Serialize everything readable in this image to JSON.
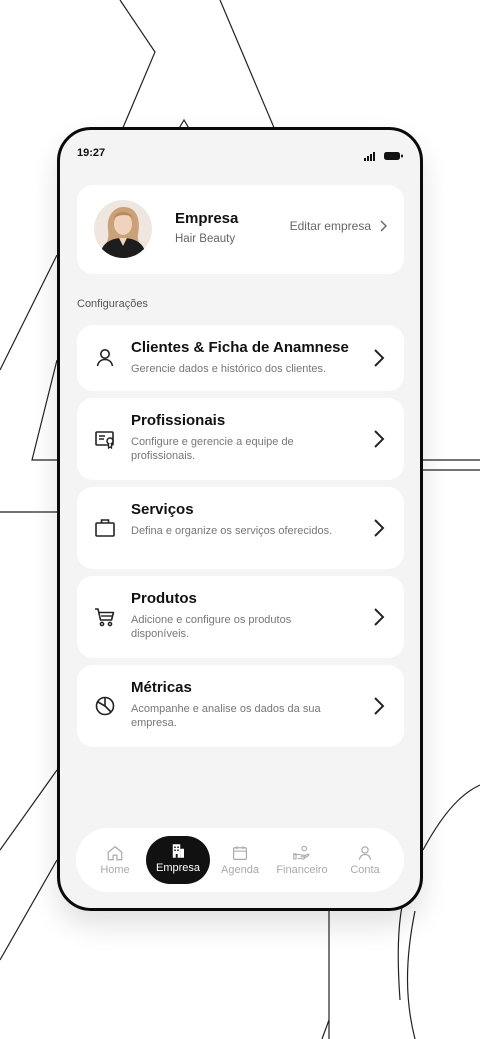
{
  "status_bar": {
    "time": "19:27"
  },
  "company": {
    "name": "Empresa",
    "subtitle": "Hair Beauty",
    "edit_label": "Editar empresa"
  },
  "section_label": "Configurações",
  "menu": [
    {
      "title": "Clientes & Ficha de Anamnese",
      "desc": "Gerencie dados e histórico dos clientes.",
      "icon": "user-icon"
    },
    {
      "title": "Profissionais",
      "desc": "Configure e gerencie a equipe de profissionais.",
      "icon": "id-badge-icon"
    },
    {
      "title": "Serviços",
      "desc": "Defina e organize os serviços oferecidos.",
      "icon": "briefcase-icon"
    },
    {
      "title": "Produtos",
      "desc": "Adicione e configure os produtos disponíveis.",
      "icon": "cart-icon"
    },
    {
      "title": "Métricas",
      "desc": "Acompanhe e analise os dados da sua empresa.",
      "icon": "pie-chart-icon"
    }
  ],
  "nav": [
    {
      "label": "Home",
      "icon": "home-icon"
    },
    {
      "label": "Empresa",
      "icon": "building-icon",
      "active": true
    },
    {
      "label": "Agenda",
      "icon": "calendar-icon"
    },
    {
      "label": "Financeiro",
      "icon": "hand-money-icon"
    },
    {
      "label": "Conta",
      "icon": "account-icon"
    }
  ],
  "colors": {
    "accent": "#111111",
    "background": "#f4f4f4",
    "card": "#ffffff",
    "muted_text": "#777777"
  }
}
